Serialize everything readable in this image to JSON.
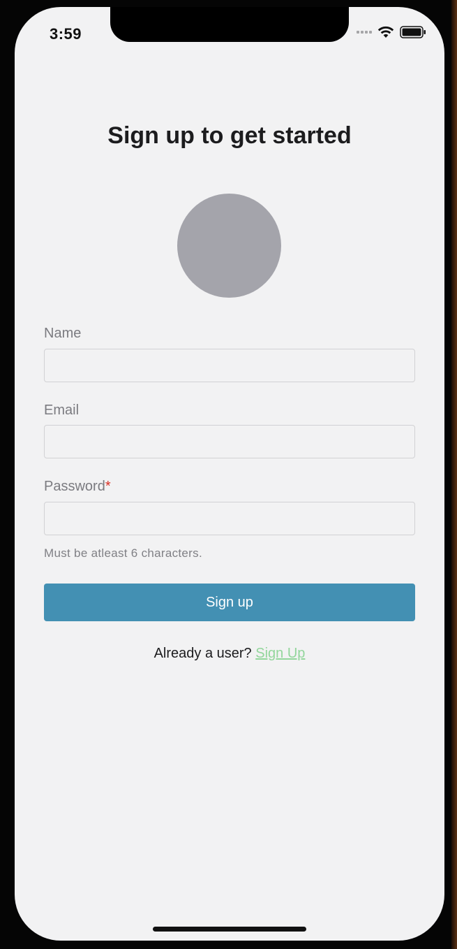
{
  "status_bar": {
    "time": "3:59",
    "icons": [
      "cellular-signal-icon",
      "wifi-icon",
      "battery-icon"
    ]
  },
  "page": {
    "title": "Sign up to get started"
  },
  "form": {
    "name_label": "Name",
    "name_value": "",
    "email_label": "Email",
    "email_value": "",
    "password_label": "Password",
    "password_required_marker": "*",
    "password_value": "",
    "password_hint": "Must be atleast 6 characters.",
    "submit_label": "Sign up"
  },
  "footer": {
    "prompt": "Already a user? ",
    "link_label": "Sign Up"
  },
  "colors": {
    "background": "#f2f2f3",
    "primary_button": "#4390b3",
    "link": "#93d69c",
    "avatar_placeholder": "#a4a4ab",
    "required_marker": "#d93025"
  }
}
